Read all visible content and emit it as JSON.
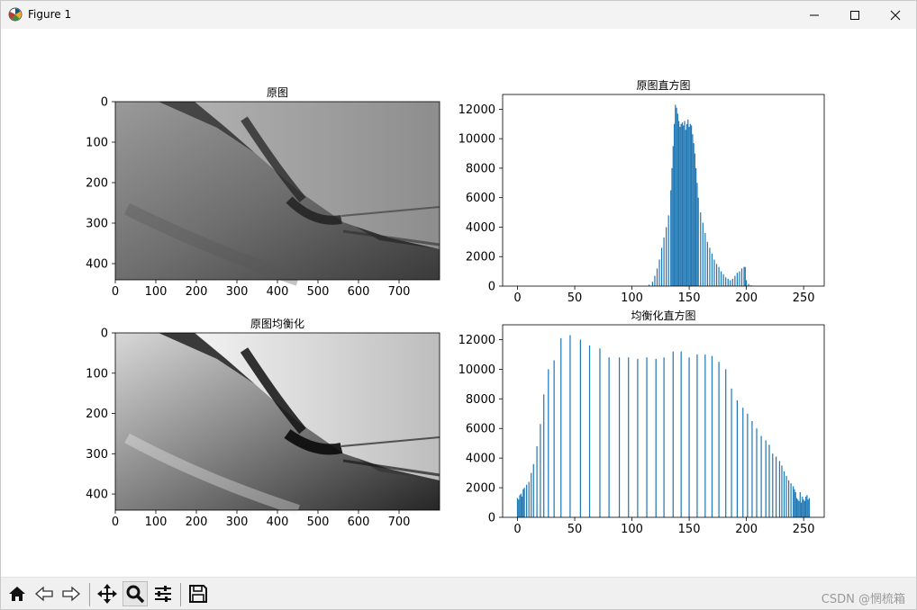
{
  "window": {
    "title": "Figure 1"
  },
  "watermark": "CSDN @惘梳箱",
  "toolbar": {
    "buttons": [
      {
        "name": "home-button",
        "icon": "home-icon"
      },
      {
        "name": "back-button",
        "icon": "arrow-left-icon"
      },
      {
        "name": "forward-button",
        "icon": "arrow-right-icon"
      },
      {
        "name": "pan-button",
        "icon": "move-icon"
      },
      {
        "name": "zoom-button",
        "icon": "magnifier-icon"
      },
      {
        "name": "subplots-button",
        "icon": "sliders-icon"
      },
      {
        "name": "save-button",
        "icon": "floppy-icon"
      }
    ]
  },
  "chart_data": [
    {
      "type": "image",
      "title": "原图",
      "xticks": [
        "0",
        "100",
        "200",
        "300",
        "400",
        "500",
        "600",
        "700"
      ],
      "yticks": [
        "0",
        "100",
        "200",
        "300",
        "400"
      ],
      "xlim": [
        0,
        800
      ],
      "ylim": [
        440,
        0
      ],
      "colormap": "gray"
    },
    {
      "type": "bar",
      "title": "原图直方图",
      "xticks": [
        "0",
        "50",
        "100",
        "150",
        "200",
        "250"
      ],
      "yticks": [
        "0",
        "2000",
        "4000",
        "6000",
        "8000",
        "10000",
        "12000"
      ],
      "xlim": [
        -13,
        268
      ],
      "ylim": [
        0,
        13000
      ],
      "x": [
        115,
        118,
        120,
        122,
        124,
        126,
        128,
        130,
        132,
        134,
        135,
        136,
        137,
        138,
        139,
        140,
        141,
        142,
        143,
        144,
        145,
        146,
        147,
        148,
        149,
        150,
        151,
        152,
        153,
        154,
        155,
        156,
        157,
        158,
        160,
        162,
        164,
        166,
        168,
        170,
        172,
        174,
        176,
        178,
        180,
        182,
        184,
        186,
        188,
        190,
        192,
        194,
        196,
        198,
        199,
        200,
        202,
        204
      ],
      "values": [
        100,
        300,
        700,
        1200,
        1800,
        2600,
        3300,
        4000,
        4800,
        6500,
        8000,
        9500,
        11000,
        12300,
        12100,
        11700,
        11200,
        10800,
        11000,
        11100,
        10900,
        11200,
        10600,
        11000,
        11300,
        10800,
        11000,
        10900,
        10300,
        9700,
        9000,
        8000,
        7000,
        6000,
        5000,
        4300,
        3600,
        3000,
        2600,
        2200,
        1800,
        1500,
        1300,
        1000,
        800,
        600,
        500,
        400,
        500,
        700,
        900,
        1000,
        1200,
        1300,
        1300,
        400,
        150,
        50
      ]
    },
    {
      "type": "image",
      "title": "原图均衡化",
      "xticks": [
        "0",
        "100",
        "200",
        "300",
        "400",
        "500",
        "600",
        "700"
      ],
      "yticks": [
        "0",
        "100",
        "200",
        "300",
        "400"
      ],
      "xlim": [
        0,
        800
      ],
      "ylim": [
        440,
        0
      ],
      "colormap": "gray"
    },
    {
      "type": "bar",
      "title": "均衡化直方图",
      "xticks": [
        "0",
        "50",
        "100",
        "150",
        "200",
        "250"
      ],
      "yticks": [
        "0",
        "2000",
        "4000",
        "6000",
        "8000",
        "10000",
        "12000"
      ],
      "xlim": [
        -13,
        268
      ],
      "ylim": [
        0,
        13000
      ],
      "x": [
        0,
        1,
        2,
        3,
        4,
        5,
        6,
        8,
        10,
        12,
        14,
        17,
        20,
        23,
        27,
        32,
        38,
        46,
        55,
        63,
        72,
        80,
        89,
        97,
        105,
        113,
        121,
        128,
        136,
        143,
        150,
        157,
        164,
        170,
        176,
        182,
        187,
        192,
        197,
        201,
        205,
        209,
        213,
        217,
        220,
        223,
        226,
        229,
        231,
        233,
        235,
        237,
        239,
        241,
        242,
        243,
        244,
        245,
        246,
        247,
        248,
        249,
        250,
        251,
        252,
        253,
        254,
        255
      ],
      "values": [
        1300,
        1200,
        1500,
        1600,
        1400,
        1900,
        2000,
        2200,
        2400,
        3000,
        3600,
        4800,
        6300,
        8300,
        10000,
        10600,
        12100,
        12300,
        12000,
        11600,
        11400,
        10800,
        10800,
        10800,
        10700,
        10800,
        10700,
        10800,
        11200,
        11200,
        10800,
        11000,
        11000,
        10900,
        10500,
        10000,
        8700,
        7900,
        7400,
        7000,
        6500,
        6000,
        5500,
        5200,
        4900,
        4300,
        4100,
        3800,
        3500,
        3100,
        2800,
        2500,
        2300,
        2100,
        1900,
        1700,
        1300,
        1200,
        1100,
        1700,
        1000,
        1400,
        1200,
        1100,
        1400,
        1500,
        1200,
        1300
      ]
    }
  ]
}
